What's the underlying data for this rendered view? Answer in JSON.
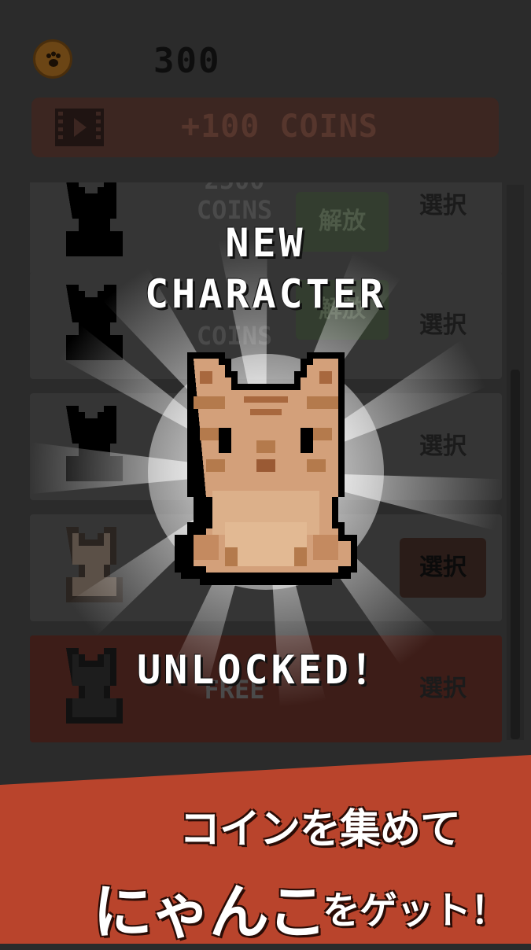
{
  "header": {
    "coin_icon": "paw-coin-icon",
    "coin_count": "300",
    "video_button_label": "+100 COINS",
    "video_icon": "film-icon"
  },
  "characters": [
    {
      "price": "2500\nCOINS",
      "unlock_label": "解放",
      "select_label": "選択",
      "color": "#000000"
    },
    {
      "price": "COINS",
      "unlock_label": "解放",
      "select_label": "選択",
      "color": "#000000"
    },
    {
      "price": "",
      "unlock_label": "",
      "select_label": "選択",
      "color": "#000000"
    },
    {
      "price": "",
      "unlock_label": "",
      "select_label": "選択",
      "color": "#c9b49a"
    },
    {
      "price": "FREE",
      "unlock_label": "",
      "select_label": "選択",
      "color": "#1a1a1a"
    }
  ],
  "overlay": {
    "title_line1": "NEW",
    "title_line2": "CHARACTER",
    "subtitle": "UNLOCKED！"
  },
  "banner": {
    "line1": "コインを集めて",
    "line2_big": "にゃんこ",
    "line2_small": "をゲット！",
    "color": "#b9442c"
  }
}
